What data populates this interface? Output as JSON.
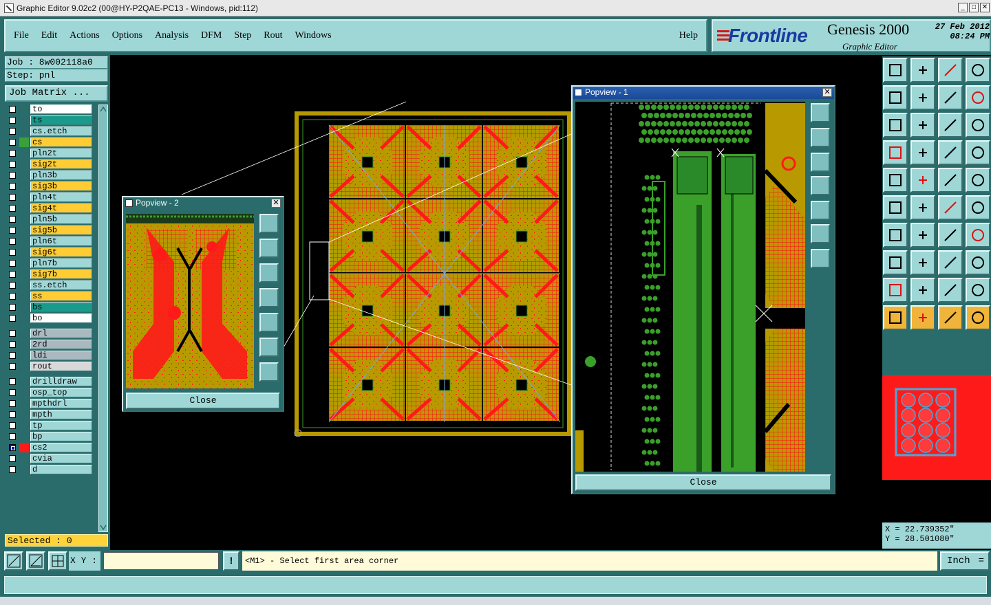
{
  "window": {
    "title": "Graphic Editor 9.02c2 (00@HY-P2QAE-PC13 - Windows, pid:112)"
  },
  "menu": [
    "File",
    "Edit",
    "Actions",
    "Options",
    "Analysis",
    "DFM",
    "Step",
    "Rout",
    "Windows"
  ],
  "help_label": "Help",
  "brand": {
    "logo": "Frontline",
    "product": "Genesis 2000",
    "subtitle": "Graphic Editor",
    "date_line1": "27 Feb 2012",
    "date_line2": "08:24 PM"
  },
  "job": {
    "job_label": "Job : 8w002118a0",
    "step_label": "Step: pnl",
    "matrix_button": "Job Matrix ..."
  },
  "layers": [
    {
      "name": "to",
      "color": "#ffffff",
      "swatch": ""
    },
    {
      "name": "ts",
      "color": "#1a9a8a",
      "swatch": ""
    },
    {
      "name": "cs.etch",
      "color": "#9fd7d7",
      "swatch": ""
    },
    {
      "name": "cs",
      "color": "#ffcc33",
      "swatch": "#3aa03a"
    },
    {
      "name": "pln2t",
      "color": "#9fd7d7",
      "swatch": ""
    },
    {
      "name": "sig2t",
      "color": "#ffcc33",
      "swatch": ""
    },
    {
      "name": "pln3b",
      "color": "#9fd7d7",
      "swatch": ""
    },
    {
      "name": "sig3b",
      "color": "#ffcc33",
      "swatch": ""
    },
    {
      "name": "pln4t",
      "color": "#9fd7d7",
      "swatch": ""
    },
    {
      "name": "sig4t",
      "color": "#ffcc33",
      "swatch": ""
    },
    {
      "name": "pln5b",
      "color": "#9fd7d7",
      "swatch": ""
    },
    {
      "name": "sig5b",
      "color": "#ffcc33",
      "swatch": ""
    },
    {
      "name": "pln6t",
      "color": "#9fd7d7",
      "swatch": ""
    },
    {
      "name": "sig6t",
      "color": "#ffcc33",
      "swatch": ""
    },
    {
      "name": "pln7b",
      "color": "#9fd7d7",
      "swatch": ""
    },
    {
      "name": "sig7b",
      "color": "#ffcc33",
      "swatch": ""
    },
    {
      "name": "ss.etch",
      "color": "#9fd7d7",
      "swatch": ""
    },
    {
      "name": "ss",
      "color": "#ffcc33",
      "swatch": ""
    },
    {
      "name": "bs",
      "color": "#1a9a8a",
      "swatch": ""
    },
    {
      "name": "bo",
      "color": "#ffffff",
      "swatch": ""
    },
    {
      "name": "drl",
      "color": "#aab8c0",
      "swatch": ""
    },
    {
      "name": "2rd",
      "color": "#aab8c0",
      "swatch": ""
    },
    {
      "name": "ldi",
      "color": "#aab8c0",
      "swatch": ""
    },
    {
      "name": "rout",
      "color": "#d8d8d8",
      "swatch": ""
    },
    {
      "name": "drilldraw",
      "color": "#9fd7d7",
      "swatch": ""
    },
    {
      "name": "osp_top",
      "color": "#9fd7d7",
      "swatch": ""
    },
    {
      "name": "mpthdrl",
      "color": "#9fd7d7",
      "swatch": ""
    },
    {
      "name": "mpth",
      "color": "#9fd7d7",
      "swatch": ""
    },
    {
      "name": "tp",
      "color": "#9fd7d7",
      "swatch": ""
    },
    {
      "name": "bp",
      "color": "#9fd7d7",
      "swatch": ""
    },
    {
      "name": "cs2",
      "color": "#9fd7d7",
      "swatch": "#ff1a1a",
      "checked": true
    },
    {
      "name": "cvia",
      "color": "#9fd7d7",
      "swatch": ""
    },
    {
      "name": "d",
      "color": "#9fd7d7",
      "swatch": ""
    }
  ],
  "selected_label": "Selected : 0",
  "popview1": {
    "title": "Popview - 1",
    "close_label": "Close"
  },
  "popview2": {
    "title": "Popview - 2",
    "close_label": "Close"
  },
  "command": {
    "xy_label": "X Y :",
    "xy_value": "",
    "bang": "!",
    "prompt": "<M1> - Select first area corner",
    "units": "Inch"
  },
  "coords": {
    "x": "X = 22.739352\"",
    "y": "Y = 28.501080\""
  },
  "colors": {
    "panel": "#2a6b6b",
    "button": "#9fd7d7",
    "copper": "#b89a00",
    "pad": "#ff1a1a",
    "trace": "#3aa02a"
  },
  "toolbar_icons": [
    "zoom-home-icon",
    "zoom-fit-icon",
    "home-icon",
    "window-icon",
    "pan-left-icon",
    "pan-right-icon",
    "undo-zoom-icon",
    "redraw-icon",
    "fit-all-icon",
    "center-icon",
    "scale-1to2-icon",
    "query-icon",
    "measure-icon",
    "grid-icon",
    "layer-compare-icon",
    "layer-swap-icon",
    "pad-select-icon",
    "contour-icon",
    "ruler-icon",
    "dot-icon",
    "connect-icon",
    "delete-icon",
    "move-icon",
    "move-copy-icon",
    "line-icon",
    "slash-icon",
    "rotate-icon",
    "mirror-icon",
    "add-pad-icon",
    "line-h-icon",
    "resize-icon",
    "cluster-icon",
    "angle-a-icon",
    "angle-b-icon",
    "angle-c-icon",
    "angle-d-icon",
    "pointer-icon",
    "select-icon",
    "select-alt-icon",
    "net-icon"
  ]
}
